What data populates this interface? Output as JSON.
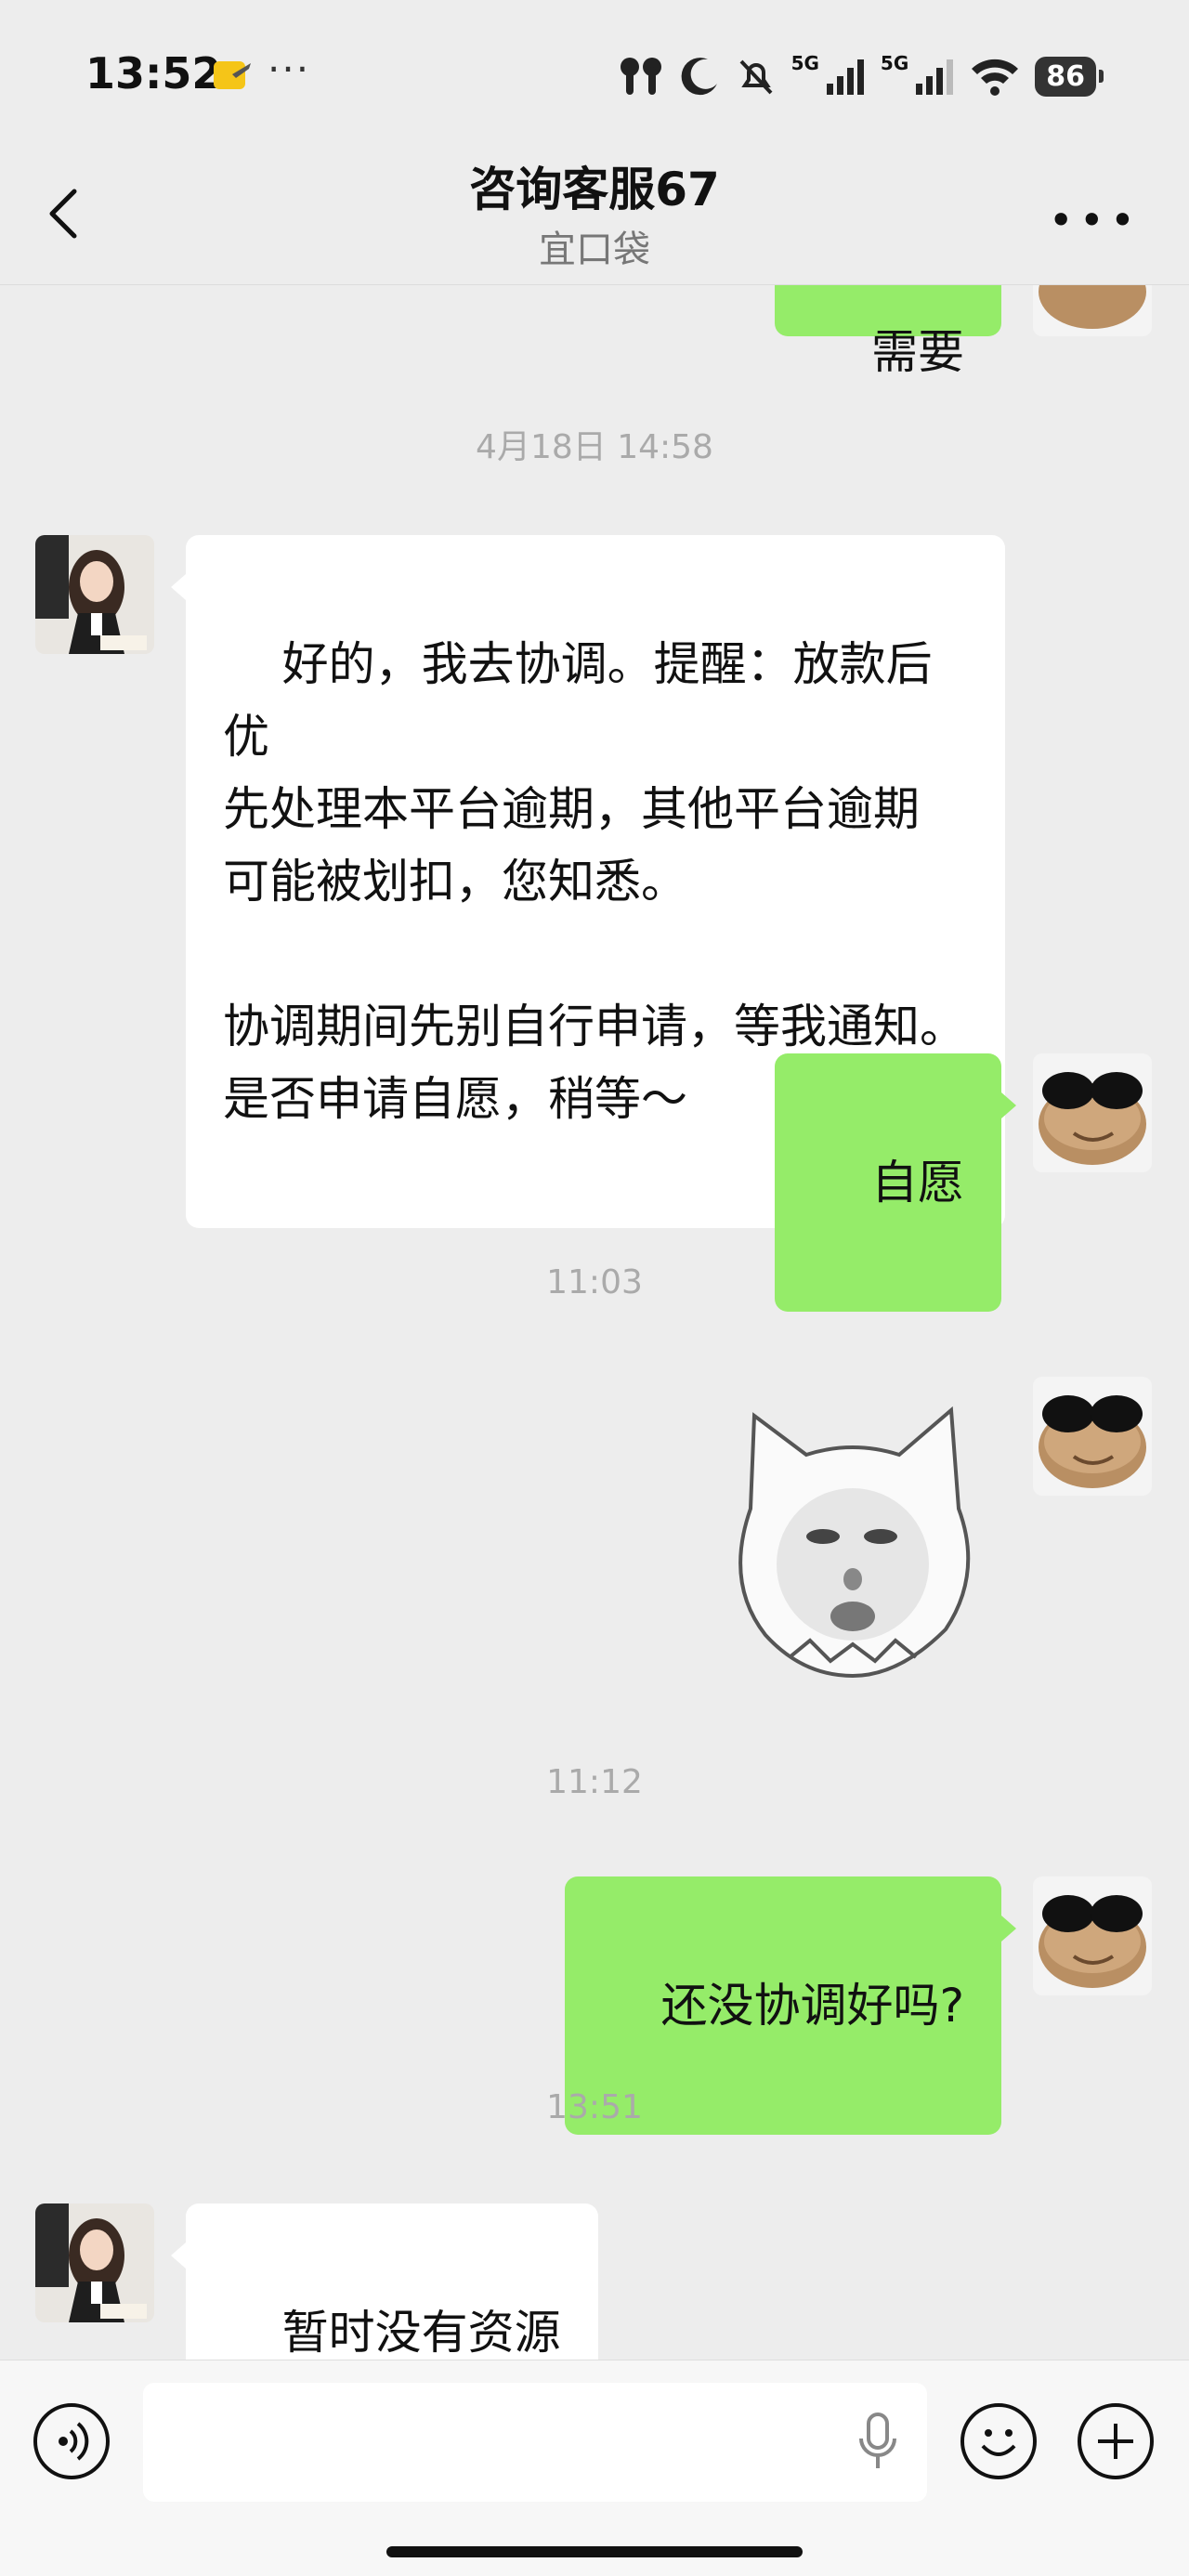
{
  "status_bar": {
    "time": "13:52",
    "dots": "···",
    "signal1_tag": "5G",
    "signal2_tag": "5G",
    "battery": "86"
  },
  "header": {
    "title": "咨询客服67",
    "subtitle": "宜口袋",
    "back_icon": "chevron-left-icon",
    "more_icon": "more-dots-icon"
  },
  "chat": {
    "top_partial_text": "需要",
    "messages": [
      {
        "type": "timestamp",
        "text": "4月18日 14:58"
      },
      {
        "type": "incoming",
        "text": "好的，我去协调。提醒：放款后优\n先处理本平台逾期，其他平台逾期\n可能被划扣，您知悉。\n\n协调期间先别自行申请，等我通知。\n是否申请自愿，稍等～"
      },
      {
        "type": "outgoing",
        "text": "自愿"
      },
      {
        "type": "timestamp",
        "text": "11:03"
      },
      {
        "type": "outgoing-sticker",
        "sticker": "cat-face-sticker"
      },
      {
        "type": "timestamp",
        "text": "11:12"
      },
      {
        "type": "outgoing",
        "text": "还没协调好吗?"
      },
      {
        "type": "timestamp",
        "text": "13:51"
      },
      {
        "type": "incoming",
        "text": "暂时没有资源"
      }
    ]
  },
  "input_bar": {
    "voice_icon": "voice-icon",
    "mic_icon": "mic-icon",
    "emoji_icon": "emoji-icon",
    "plus_icon": "plus-icon",
    "text_value": ""
  },
  "colors": {
    "background": "#ededed",
    "outgoing_bubble": "#95ec69",
    "incoming_bubble": "#ffffff"
  }
}
